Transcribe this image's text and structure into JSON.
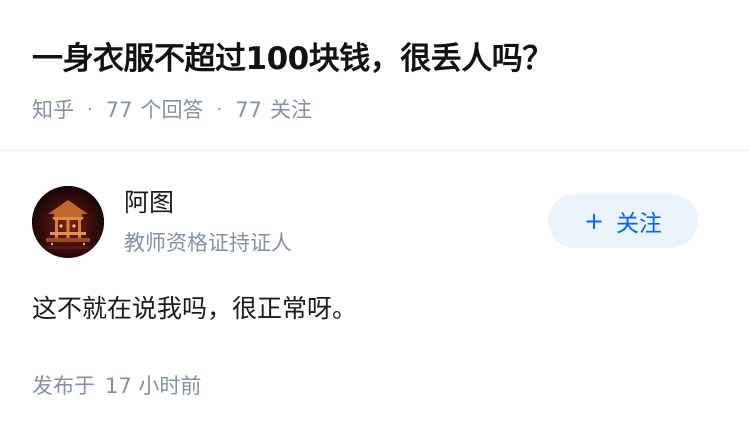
{
  "question": {
    "title": "一身衣服不超过100块钱，很丢人吗？",
    "source": "知乎",
    "answer_count": "77",
    "answer_label": "个回答",
    "follow_count": "77",
    "follow_label": "关注"
  },
  "answer": {
    "author": {
      "name": "阿图",
      "badge": "教师资格证持证人",
      "avatar_icon": "avatar-image"
    },
    "follow_button": {
      "icon": "plus-icon",
      "label": "关注"
    },
    "content": "这不就在说我吗，很正常呀。",
    "published_prefix": "发布于",
    "published_time": "17 小时前"
  },
  "colors": {
    "accent": "#0066ff",
    "accent_bg": "#ebf3fb",
    "muted": "#8590a6",
    "text": "#191b1f"
  }
}
